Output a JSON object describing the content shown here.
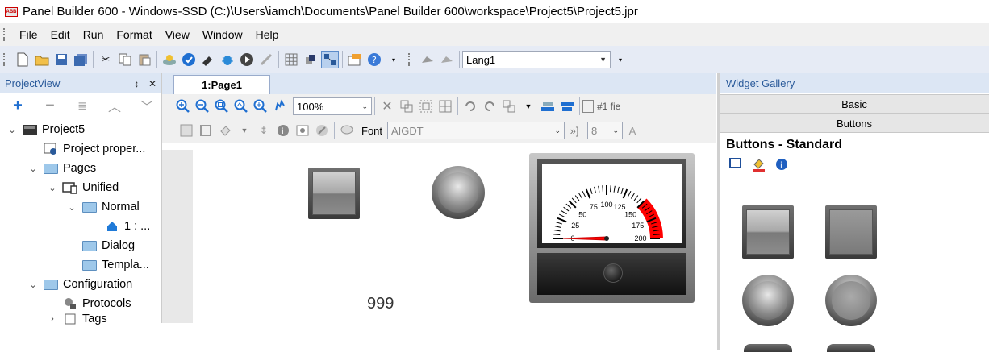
{
  "window": {
    "title": "Panel Builder 600 - Windows-SSD (C:)\\Users\\iamch\\Documents\\Panel Builder 600\\workspace\\Project5\\Project5.jpr",
    "app_icon_text": "ABB"
  },
  "menu": {
    "items": [
      "File",
      "Edit",
      "Run",
      "Format",
      "View",
      "Window",
      "Help"
    ]
  },
  "toolbar": {
    "language_combo_value": "Lang1"
  },
  "project_view": {
    "title": "ProjectView",
    "pin_glyph": "↕",
    "close_glyph": "✕",
    "tree": [
      {
        "label": "Project5",
        "level": 0,
        "expander": "⌄"
      },
      {
        "label": "Project proper...",
        "level": 1,
        "expander": ""
      },
      {
        "label": "Pages",
        "level": 1,
        "expander": "⌄"
      },
      {
        "label": "Unified",
        "level": 2,
        "expander": "⌄"
      },
      {
        "label": "Normal",
        "level": 3,
        "expander": "⌄"
      },
      {
        "label": "1 : ...",
        "level": 4,
        "expander": ""
      },
      {
        "label": "Dialog",
        "level": 3,
        "expander": ""
      },
      {
        "label": "Templa...",
        "level": 3,
        "expander": ""
      },
      {
        "label": "Configuration",
        "level": 1,
        "expander": "⌄"
      },
      {
        "label": "Protocols",
        "level": 2,
        "expander": ""
      },
      {
        "label": "Tags",
        "level": 2,
        "expander": "›"
      }
    ]
  },
  "editor": {
    "tab_label": "1:Page1",
    "zoom_value": "100%",
    "field_label": "#1 fie",
    "font_label": "Font",
    "font_value": "AIGDT",
    "font_size_value": "8",
    "canvas_text": "999",
    "gauge": {
      "value": 0,
      "min": 0,
      "max": 200,
      "ticks": [
        "0",
        "25",
        "50",
        "75",
        "100",
        "125",
        "150",
        "175",
        "200"
      ],
      "redzone_start": 150,
      "redzone_color": "#ff0000"
    }
  },
  "widget_gallery": {
    "title": "Widget Gallery",
    "categories": [
      "Basic",
      "Buttons"
    ],
    "section_title": "Buttons - Standard"
  },
  "colors": {
    "panel_header_bg": "#dce6f4",
    "toolbar_bg": "#e6ebf5",
    "accent_blue": "#2a5a9a"
  }
}
